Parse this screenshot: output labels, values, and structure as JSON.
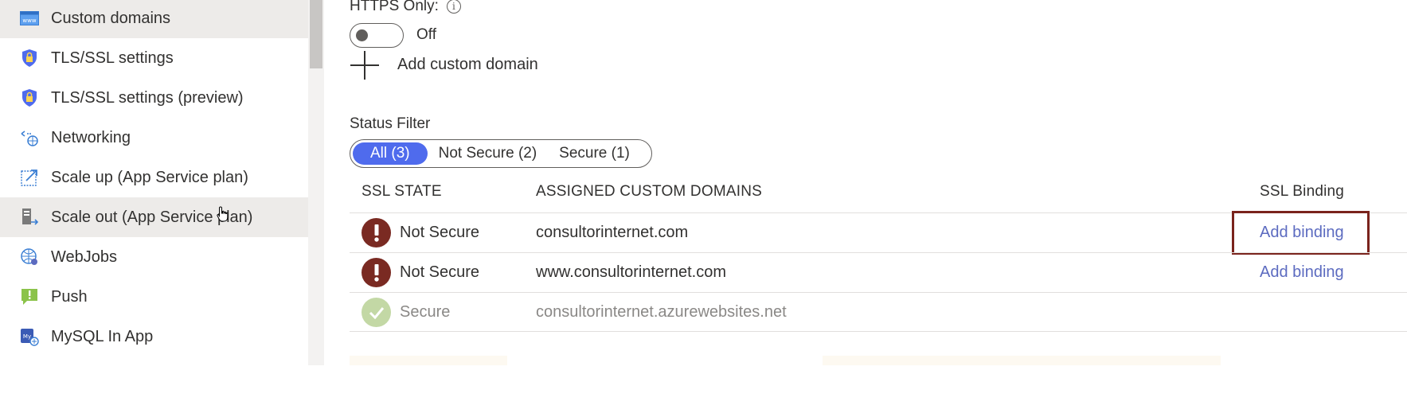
{
  "sidebar": {
    "items": [
      {
        "label": "Custom domains",
        "icon": "www-icon"
      },
      {
        "label": "TLS/SSL settings",
        "icon": "shield-lock-icon"
      },
      {
        "label": "TLS/SSL settings (preview)",
        "icon": "shield-lock-icon"
      },
      {
        "label": "Networking",
        "icon": "networking-icon"
      },
      {
        "label": "Scale up (App Service plan)",
        "icon": "scale-up-icon"
      },
      {
        "label": "Scale out (App Service plan)",
        "icon": "scale-out-icon"
      },
      {
        "label": "WebJobs",
        "icon": "webjobs-icon"
      },
      {
        "label": "Push",
        "icon": "push-icon"
      },
      {
        "label": "MySQL In App",
        "icon": "mysql-icon"
      }
    ]
  },
  "https_only": {
    "label": "HTTPS Only:",
    "state_text": "Off"
  },
  "add_custom_domain": {
    "label": "Add custom domain"
  },
  "status_filter": {
    "label": "Status Filter",
    "options": [
      "All (3)",
      "Not Secure (2)",
      "Secure (1)"
    ],
    "selected": "All (3)"
  },
  "table": {
    "headers": {
      "ssl_state": "SSL STATE",
      "domains": "ASSIGNED CUSTOM DOMAINS",
      "binding": "SSL Binding"
    },
    "rows": [
      {
        "state": "Not Secure",
        "domain": "consultorinternet.com",
        "binding": "Add binding"
      },
      {
        "state": "Not Secure",
        "domain": "www.consultorinternet.com",
        "binding": "Add binding"
      },
      {
        "state": "Secure",
        "domain": "consultorinternet.azurewebsites.net",
        "binding": ""
      }
    ]
  },
  "colors": {
    "accent": "#4f6bed",
    "link": "#5c6bc0",
    "not_secure": "#7a2a22",
    "secure": "#c3d8a5",
    "highlight_border": "#7a231c"
  }
}
